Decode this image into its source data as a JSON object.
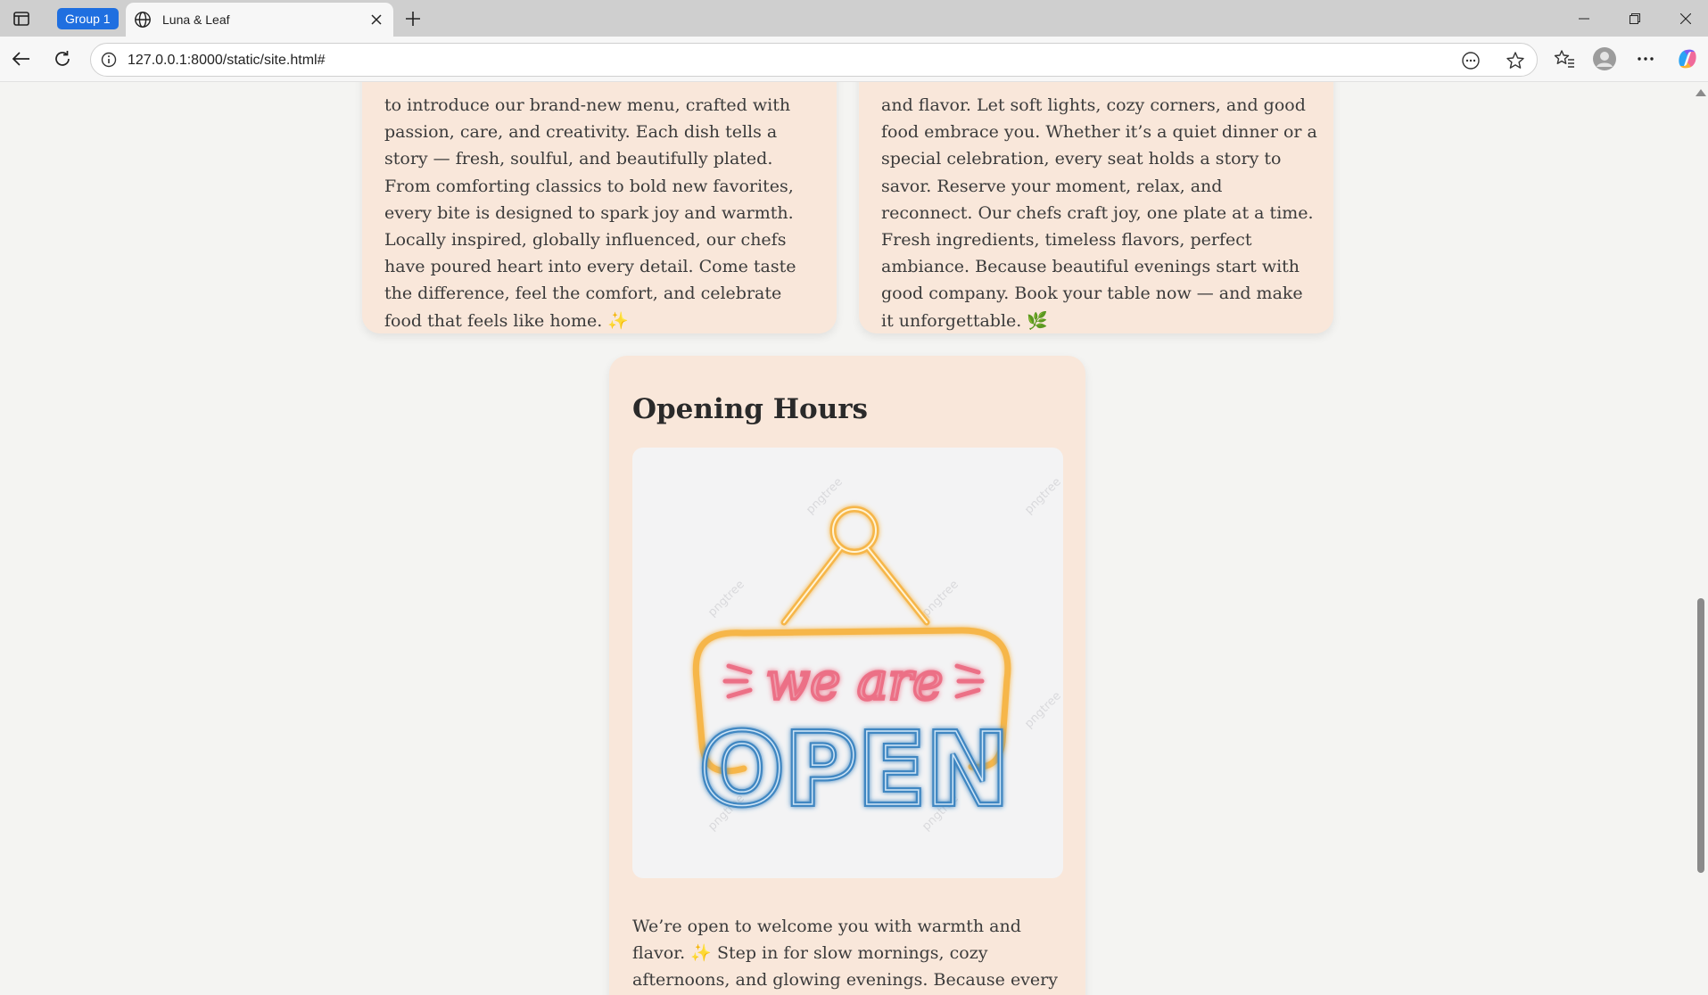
{
  "browser": {
    "group_label": "Group 1",
    "tab_title": "Luna & Leaf",
    "url": "127.0.0.1:8000/static/site.html#"
  },
  "page": {
    "menu_card": {
      "text": "to introduce our brand-new menu, crafted with passion, care, and creativity. Each dish tells a story — fresh, soulful, and beautifully plated. From comforting classics to bold new favorites, every bite is designed to spark joy and warmth. Locally inspired, globally influenced, our chefs have poured heart into every detail. Come taste the difference, feel the comfort, and celebrate food that feels like home. ✨"
    },
    "reserve_card": {
      "text": "and flavor. Let soft lights, cozy corners, and good food embrace you. Whether it’s a quiet dinner or a special celebration, every seat holds a story to savor. Reserve your moment, relax, and reconnect. Our chefs craft joy, one plate at a time. Fresh ingredients, timeless flavors, perfect ambiance. Because beautiful evenings start with good company. Book your table now — and make it unforgettable. 🌿"
    },
    "hours_card": {
      "title": "Opening Hours",
      "sign_top": "we are",
      "sign_bottom": "OPEN",
      "watermark": "pngtree",
      "text": "We’re open to welcome you with warmth and flavor. ✨ Step in for slow mornings, cozy afternoons, and glowing evenings. Because every hour here is made for"
    }
  },
  "colors": {
    "card_bg": "#f9e7da",
    "page_bg": "#f4f4f2",
    "neon_orange": "#f6b64a",
    "neon_pink": "#ec6f86",
    "neon_blue": "#3f87c2",
    "accent_blue": "#1f6fe0"
  }
}
